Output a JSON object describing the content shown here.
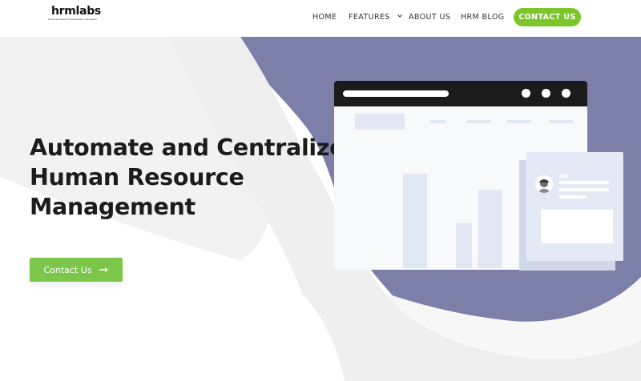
{
  "brand": {
    "name": "hrmlabs",
    "tagline": "#1 Human Resource Standard for Companies"
  },
  "nav": {
    "items": [
      {
        "label": "HOME"
      },
      {
        "label": "FEATURES"
      },
      {
        "label": "ABOUT US"
      },
      {
        "label": "HRM BLOG"
      }
    ],
    "contact_label": "CONTACT US"
  },
  "hero": {
    "headline_lines": [
      "Automate and Centralize",
      "Human Resource",
      "Management"
    ],
    "cta_label": "Contact Us"
  },
  "icons": {
    "features_dropdown": "chevron-down-icon",
    "cta": "arrow-right-icon"
  },
  "colors": {
    "accent": "#7cc52b",
    "hero_shape": "#7c7fa8",
    "text": "#1c1c1c"
  }
}
